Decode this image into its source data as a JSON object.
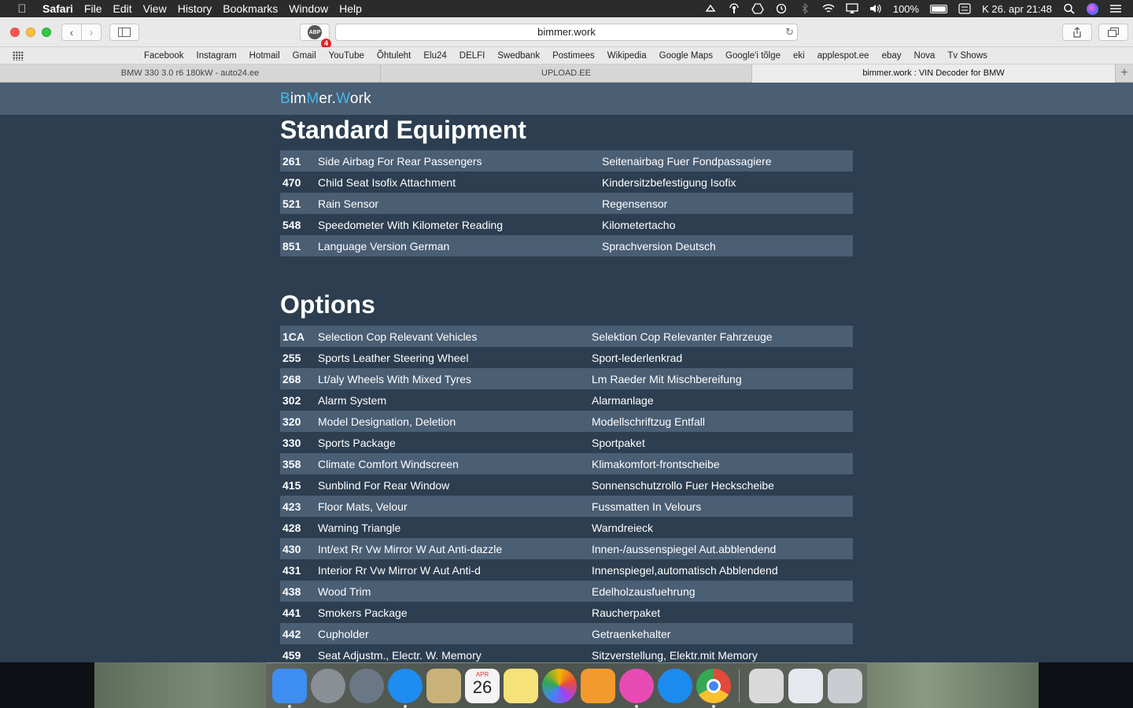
{
  "menubar": {
    "apple_icon": "apple-logo-icon",
    "app_name": "Safari",
    "menus": [
      "File",
      "Edit",
      "View",
      "History",
      "Bookmarks",
      "Window",
      "Help"
    ],
    "battery_percent": "100%",
    "datetime": "K 26. apr  21:48"
  },
  "toolbar": {
    "abp_label": "ABP",
    "abp_count": "4",
    "url": "bimmer.work"
  },
  "bookmarks": [
    "Facebook",
    "Instagram",
    "Hotmail",
    "Gmail",
    "YouTube",
    "Õhtuleht",
    "Elu24",
    "DELFI",
    "Swedbank",
    "Postimees",
    "Wikipedia",
    "Google Maps",
    "Google'i tõlge",
    "eki",
    "applespot.ee",
    "ebay",
    "Nova",
    "Tv Shows"
  ],
  "tabs": [
    {
      "title": "BMW 330 3.0 r6 180kW - auto24.ee",
      "active": false
    },
    {
      "title": "UPLOAD.EE",
      "active": false
    },
    {
      "title": "bimmer.work : VIN Decoder for BMW",
      "active": true
    }
  ],
  "site": {
    "logo": {
      "p1": "B",
      "p2": "im",
      "p3": "M",
      "p4": "er.",
      "p5": "W",
      "p6": "ork"
    },
    "accent_color": "#47b6e8",
    "standard_title": "Standard Equipment",
    "options_title": "Options"
  },
  "standard_equipment": [
    {
      "code": "261",
      "en": "Side Airbag For Rear Passengers",
      "de": "Seitenairbag Fuer Fondpassagiere"
    },
    {
      "code": "470",
      "en": "Child Seat Isofix Attachment",
      "de": "Kindersitzbefestigung Isofix"
    },
    {
      "code": "521",
      "en": "Rain Sensor",
      "de": "Regensensor"
    },
    {
      "code": "548",
      "en": "Speedometer With Kilometer Reading",
      "de": "Kilometertacho"
    },
    {
      "code": "851",
      "en": "Language Version German",
      "de": "Sprachversion Deutsch"
    }
  ],
  "options": [
    {
      "code": "1CA",
      "en": "Selection Cop Relevant Vehicles",
      "de": "Selektion Cop Relevanter Fahrzeuge"
    },
    {
      "code": "255",
      "en": "Sports Leather Steering Wheel",
      "de": "Sport-lederlenkrad"
    },
    {
      "code": "268",
      "en": "Lt/aly Wheels With Mixed Tyres",
      "de": "Lm Raeder Mit Mischbereifung"
    },
    {
      "code": "302",
      "en": "Alarm System",
      "de": "Alarmanlage"
    },
    {
      "code": "320",
      "en": "Model Designation, Deletion",
      "de": "Modellschriftzug Entfall"
    },
    {
      "code": "330",
      "en": "Sports Package",
      "de": "Sportpaket"
    },
    {
      "code": "358",
      "en": "Climate Comfort Windscreen",
      "de": "Klimakomfort-frontscheibe"
    },
    {
      "code": "415",
      "en": "Sunblind For Rear Window",
      "de": "Sonnenschutzrollo Fuer Heckscheibe"
    },
    {
      "code": "423",
      "en": "Floor Mats, Velour",
      "de": "Fussmatten In Velours"
    },
    {
      "code": "428",
      "en": "Warning Triangle",
      "de": "Warndreieck"
    },
    {
      "code": "430",
      "en": "Int/ext Rr Vw Mirror W Aut Anti-dazzle",
      "de": "Innen-/aussenspiegel Aut.abblendend"
    },
    {
      "code": "431",
      "en": "Interior Rr Vw Mirror W Aut Anti-d",
      "de": "Innenspiegel,automatisch Abblendend"
    },
    {
      "code": "438",
      "en": "Wood Trim",
      "de": "Edelholzausfuehrung"
    },
    {
      "code": "441",
      "en": "Smokers Package",
      "de": "Raucherpaket"
    },
    {
      "code": "442",
      "en": "Cupholder",
      "de": "Getraenkehalter"
    },
    {
      "code": "459",
      "en": "Seat Adjustm., Electr. W. Memory",
      "de": "Sitzverstellung, Elektr.mit Memory"
    }
  ],
  "dock": {
    "apps": [
      {
        "icon": "finder-icon",
        "color": "#3d8ef0",
        "running": true
      },
      {
        "icon": "system-preferences-icon",
        "color": "#8a8f96",
        "running": false
      },
      {
        "icon": "launchpad-icon",
        "color": "#6b7785",
        "running": false
      },
      {
        "icon": "safari-icon",
        "color": "#1e8cf0",
        "running": true
      },
      {
        "icon": "mail-icon",
        "color": "#c9b27a",
        "running": false
      },
      {
        "icon": "calendar-icon",
        "color": "#f4f4f4",
        "running": false
      },
      {
        "icon": "notes-icon",
        "color": "#f7e27a",
        "running": false
      },
      {
        "icon": "photos-icon",
        "color": "#f2f2f2",
        "running": false
      },
      {
        "icon": "pages-icon",
        "color": "#f29a2e",
        "running": false
      },
      {
        "icon": "itunes-icon",
        "color": "#e84bb3",
        "running": true
      },
      {
        "icon": "app-store-icon",
        "color": "#1b8bf0",
        "running": false
      },
      {
        "icon": "chrome-icon",
        "color": "#e24a3b",
        "running": true
      }
    ],
    "right": [
      {
        "icon": "music-folder-icon",
        "color": "#d9d9d9"
      },
      {
        "icon": "itunes-window-icon",
        "color": "#e6e8ee"
      },
      {
        "icon": "trash-icon",
        "color": "#c9ccd0"
      }
    ],
    "calendar_month": "APR",
    "calendar_day": "26"
  }
}
